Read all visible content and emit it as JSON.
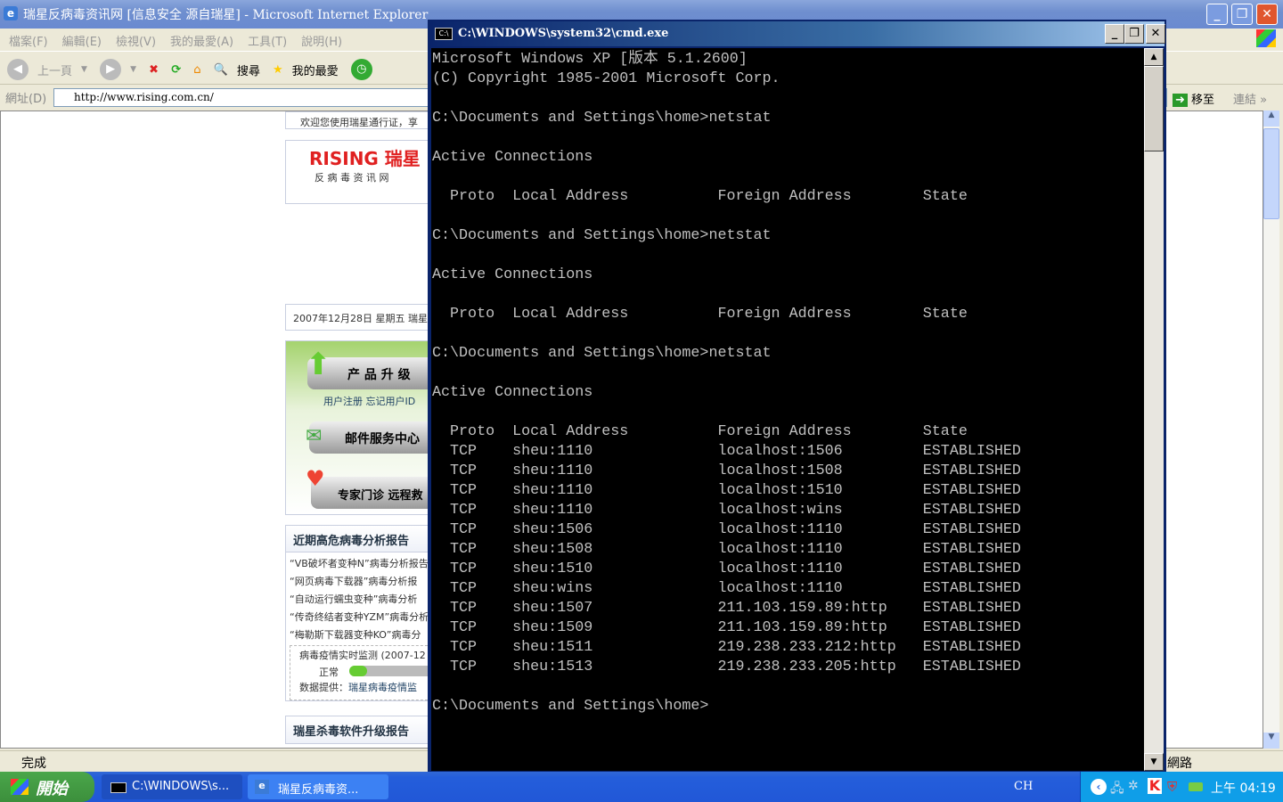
{
  "ie": {
    "title": "瑞星反病毒资讯网 [信息安全 源自瑞星] - Microsoft Internet Explorer",
    "menu": [
      "檔案(F)",
      "編輯(E)",
      "檢視(V)",
      "我的最愛(A)",
      "工具(T)",
      "說明(H)"
    ],
    "toolbar": {
      "back": "上一頁",
      "search": "搜尋",
      "favorites": "我的最愛"
    },
    "address_label": "網址(D)",
    "url": "http://www.rising.com.cn/",
    "go": "移至",
    "links": "連結",
    "status": "完成",
    "zone": "網路"
  },
  "page": {
    "welcome": "欢迎您使用瑞星通行证，享",
    "logo": "RISING 瑞星",
    "logo_sub": "反 病 毒 资 讯 网",
    "date": "2007年12月28日 星期五 瑞星",
    "upgrade": "产 品 升 级",
    "register_links": "用户注册 忘记用户ID",
    "mail": "邮件服务中心",
    "expert": "专家门诊 远程救",
    "reports_title": "近期高危病毒分析报告",
    "reports": [
      "“VB破坏者变种N”病毒分析报告",
      "“网页病毒下载器”病毒分析报",
      "“自动运行蠕虫变种”病毒分析",
      "“传奇终结者变种YZM”病毒分析",
      "“梅勒斯下载器变种KO”病毒分"
    ],
    "monitor_title": "病毒疫情实时监测 (2007-12",
    "monitor_status": "正常",
    "monitor_level": 0.2,
    "data_source_label": "数据提供：",
    "data_source": "瑞星病毒疫情监",
    "upgrade_report_title": "瑞星杀毒软件升级报告"
  },
  "cmd": {
    "title": "C:\\WINDOWS\\system32\\cmd.exe",
    "lines": [
      "Microsoft Windows XP [版本 5.1.2600]",
      "(C) Copyright 1985-2001 Microsoft Corp.",
      "",
      "C:\\Documents and Settings\\home>netstat",
      "",
      "Active Connections",
      "",
      "  Proto  Local Address          Foreign Address        State",
      "",
      "C:\\Documents and Settings\\home>netstat",
      "",
      "Active Connections",
      "",
      "  Proto  Local Address          Foreign Address        State",
      "",
      "C:\\Documents and Settings\\home>netstat",
      "",
      "Active Connections",
      "",
      "  Proto  Local Address          Foreign Address        State",
      "  TCP    sheu:1110              localhost:1506         ESTABLISHED",
      "  TCP    sheu:1110              localhost:1508         ESTABLISHED",
      "  TCP    sheu:1110              localhost:1510         ESTABLISHED",
      "  TCP    sheu:1110              localhost:wins         ESTABLISHED",
      "  TCP    sheu:1506              localhost:1110         ESTABLISHED",
      "  TCP    sheu:1508              localhost:1110         ESTABLISHED",
      "  TCP    sheu:1510              localhost:1110         ESTABLISHED",
      "  TCP    sheu:wins              localhost:1110         ESTABLISHED",
      "  TCP    sheu:1507              211.103.159.89:http    ESTABLISHED",
      "  TCP    sheu:1509              211.103.159.89:http    ESTABLISHED",
      "  TCP    sheu:1511              219.238.233.212:http   ESTABLISHED",
      "  TCP    sheu:1513              219.238.233.205:http   ESTABLISHED",
      "",
      "C:\\Documents and Settings\\home>"
    ]
  },
  "taskbar": {
    "start": "開始",
    "tasks": [
      "C:\\WINDOWS\\s...",
      "瑞星反病毒资..."
    ],
    "lang": "CH",
    "clock": "上午 04:19"
  },
  "colors": {
    "console_bg": "#000000",
    "console_fg": "#c0c0c0",
    "title_active": "#0a246a",
    "rising_red": "#e02020"
  }
}
